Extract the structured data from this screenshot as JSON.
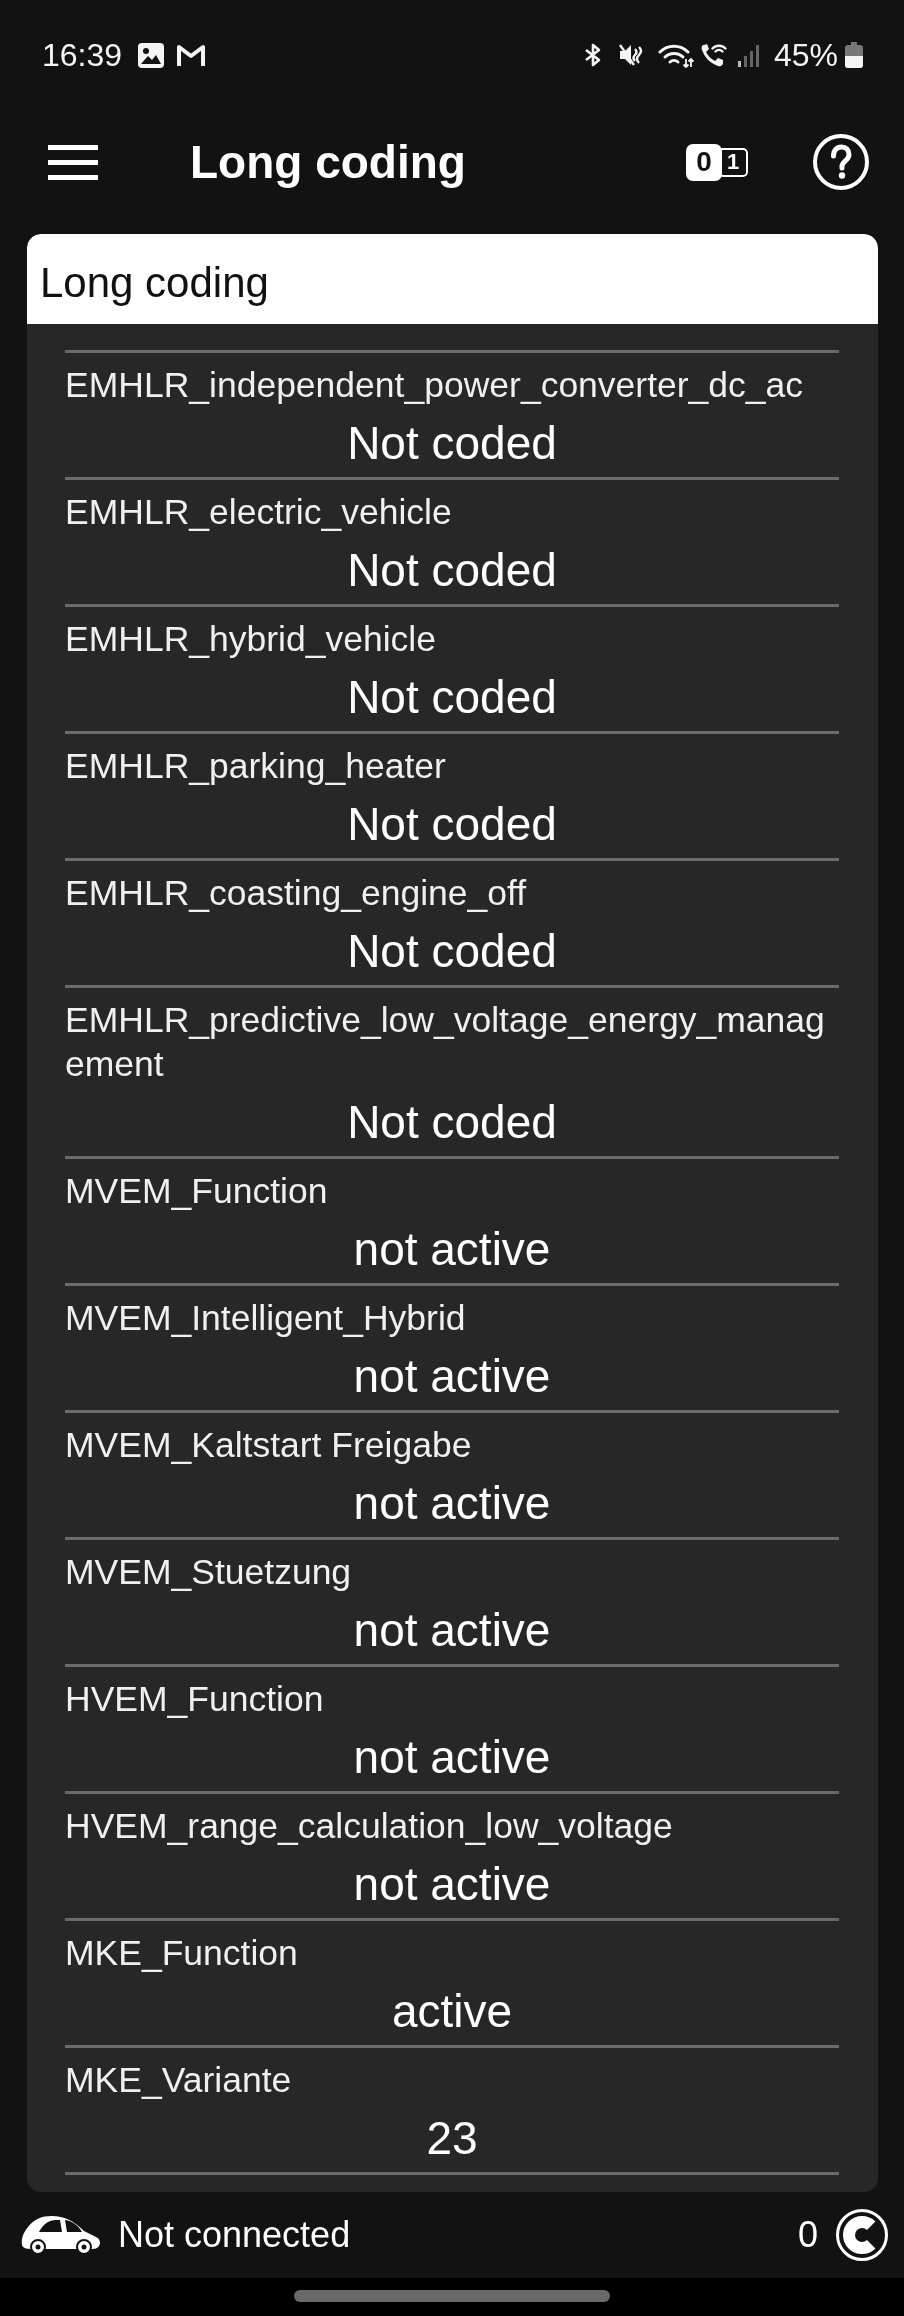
{
  "status_bar": {
    "time": "16:39",
    "battery": "45%"
  },
  "app_bar": {
    "title": "Long coding",
    "toggle": [
      {
        "label": "0",
        "selected": true
      },
      {
        "label": "1",
        "selected": false
      }
    ]
  },
  "section": {
    "title": "Long coding",
    "rows": [
      {
        "label": "EMHLR_independent_power_converter_dc_ac",
        "value": "Not coded"
      },
      {
        "label": "EMHLR_electric_vehicle",
        "value": "Not coded"
      },
      {
        "label": "EMHLR_hybrid_vehicle",
        "value": "Not coded"
      },
      {
        "label": "EMHLR_parking_heater",
        "value": "Not coded"
      },
      {
        "label": "EMHLR_coasting_engine_off",
        "value": "Not coded"
      },
      {
        "label": "EMHLR_predictive_low_voltage_energy_management",
        "value": "Not coded"
      },
      {
        "label": "MVEM_Function",
        "value": "not active"
      },
      {
        "label": "MVEM_Intelligent_Hybrid",
        "value": "not active"
      },
      {
        "label": "MVEM_Kaltstart Freigabe",
        "value": "not active"
      },
      {
        "label": "MVEM_Stuetzung",
        "value": "not active"
      },
      {
        "label": "HVEM_Function",
        "value": "not active"
      },
      {
        "label": "HVEM_range_calculation_low_voltage",
        "value": "not active"
      },
      {
        "label": "MKE_Function",
        "value": "active"
      },
      {
        "label": "MKE_Variante",
        "value": "23"
      }
    ]
  },
  "footer": {
    "status": "Not connected",
    "count": "0"
  }
}
